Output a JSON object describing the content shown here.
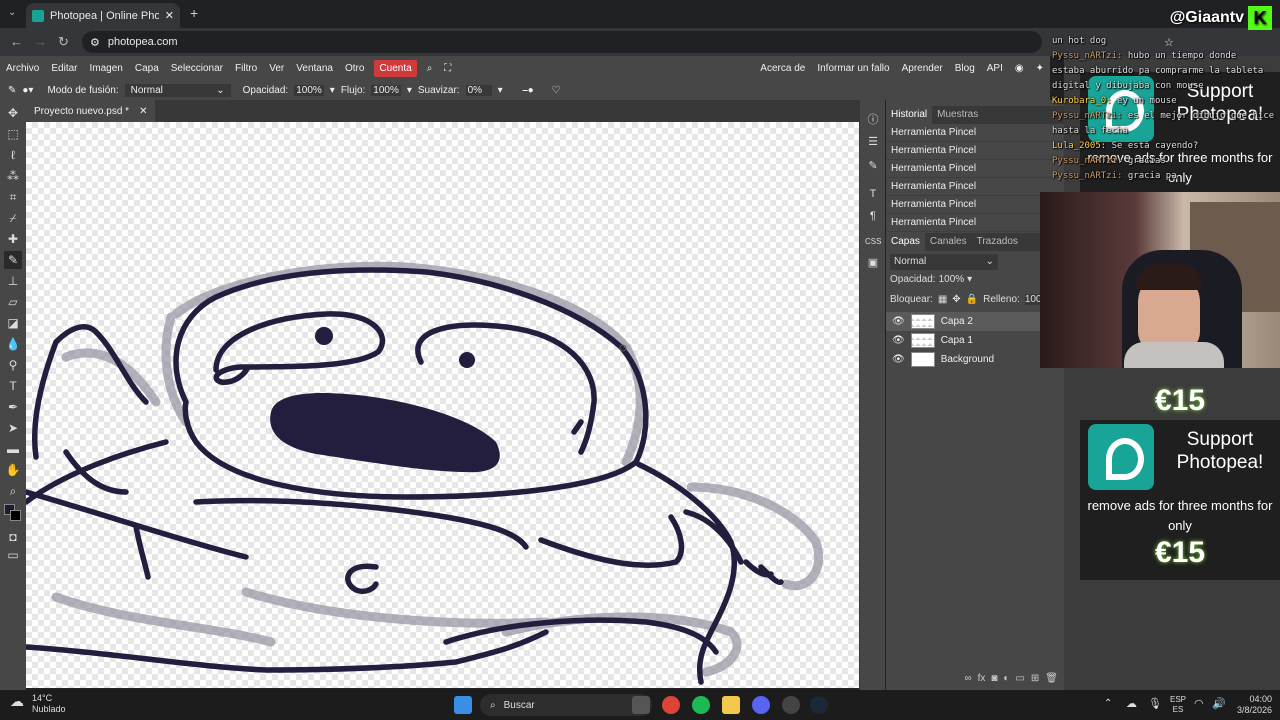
{
  "browser": {
    "tab_title": "Photopea | Online Photo Editor",
    "url": "photopea.com"
  },
  "menu": {
    "items": [
      "Archivo",
      "Editar",
      "Imagen",
      "Capa",
      "Seleccionar",
      "Filtro",
      "Ver",
      "Ventana",
      "Otro"
    ],
    "account": "Cuenta",
    "right_items": [
      "Acerca de",
      "Informar un fallo",
      "Aprender",
      "Blog",
      "API"
    ]
  },
  "options": {
    "blend_label": "Modo de fusión:",
    "blend_value": "Normal",
    "opacity_label": "Opacidad:",
    "opacity_value": "100%",
    "flow_label": "Flujo:",
    "flow_value": "100%",
    "smooth_label": "Suavizar:",
    "smooth_value": "0%"
  },
  "document": {
    "tab_title": "Proyecto nuevo.psd *"
  },
  "history_panel": {
    "tabs": [
      "Historial",
      "Muestras"
    ],
    "items": [
      "Herramienta Pincel",
      "Herramienta Pincel",
      "Herramienta Pincel",
      "Herramienta Pincel",
      "Herramienta Pincel",
      "Herramienta Pincel"
    ]
  },
  "layers_panel": {
    "tabs": [
      "Capas",
      "Canales",
      "Trazados"
    ],
    "blend_mode": "Normal",
    "opacity_label": "Opacidad:",
    "opacity_value": "100%",
    "lock_label": "Bloquear:",
    "fill_label": "Relleno:",
    "fill_value": "100%",
    "layers": [
      {
        "name": "Capa 2",
        "selected": true
      },
      {
        "name": "Capa 1",
        "selected": false
      },
      {
        "name": "Background",
        "selected": false
      }
    ]
  },
  "ads": [
    {
      "line1": "Support",
      "line2": "Photopea!",
      "body": "remove ads for three months for only",
      "price": "€15"
    },
    {
      "line1": "Support",
      "line2": "Photopea!",
      "body": "remove ads for three months for only",
      "price": "€15"
    }
  ],
  "stream": {
    "handle": "@Giaantv",
    "chat": [
      {
        "user": "",
        "text": "un hot dog"
      },
      {
        "user": "Pyssu_nARTzi:",
        "text": "hubo un tiempo donde"
      },
      {
        "user": "",
        "text": "estaba aburrido pa comprarme la tableta"
      },
      {
        "user": "",
        "text": "digital y dibujaba con mouse"
      },
      {
        "user": "Kurobara_0:",
        "text": "ey un mouse"
      },
      {
        "user": "Pyssu_nARTzi:",
        "text": "es el mejor dibujo que hice"
      },
      {
        "user": "",
        "text": "hasta la fecha"
      },
      {
        "user": "Lula_2005:",
        "text": "Se está cayendo?"
      },
      {
        "user": "Pyssu_nARTzi:",
        "text": "gracias"
      },
      {
        "user": "Pyssu_nARTzi:",
        "text": "gracia pa"
      }
    ]
  },
  "taskbar": {
    "weather_temp": "14°C",
    "weather_desc": "Nublado",
    "search_placeholder": "Buscar",
    "lang_top": "ESP",
    "lang_bottom": "ES",
    "time": "04:00",
    "date": "3/8/2026"
  },
  "colors": {
    "accent": "#18a497",
    "stroke": "#231d3e",
    "account_red": "#d13a3a",
    "price_glow": "#7bd33a"
  }
}
